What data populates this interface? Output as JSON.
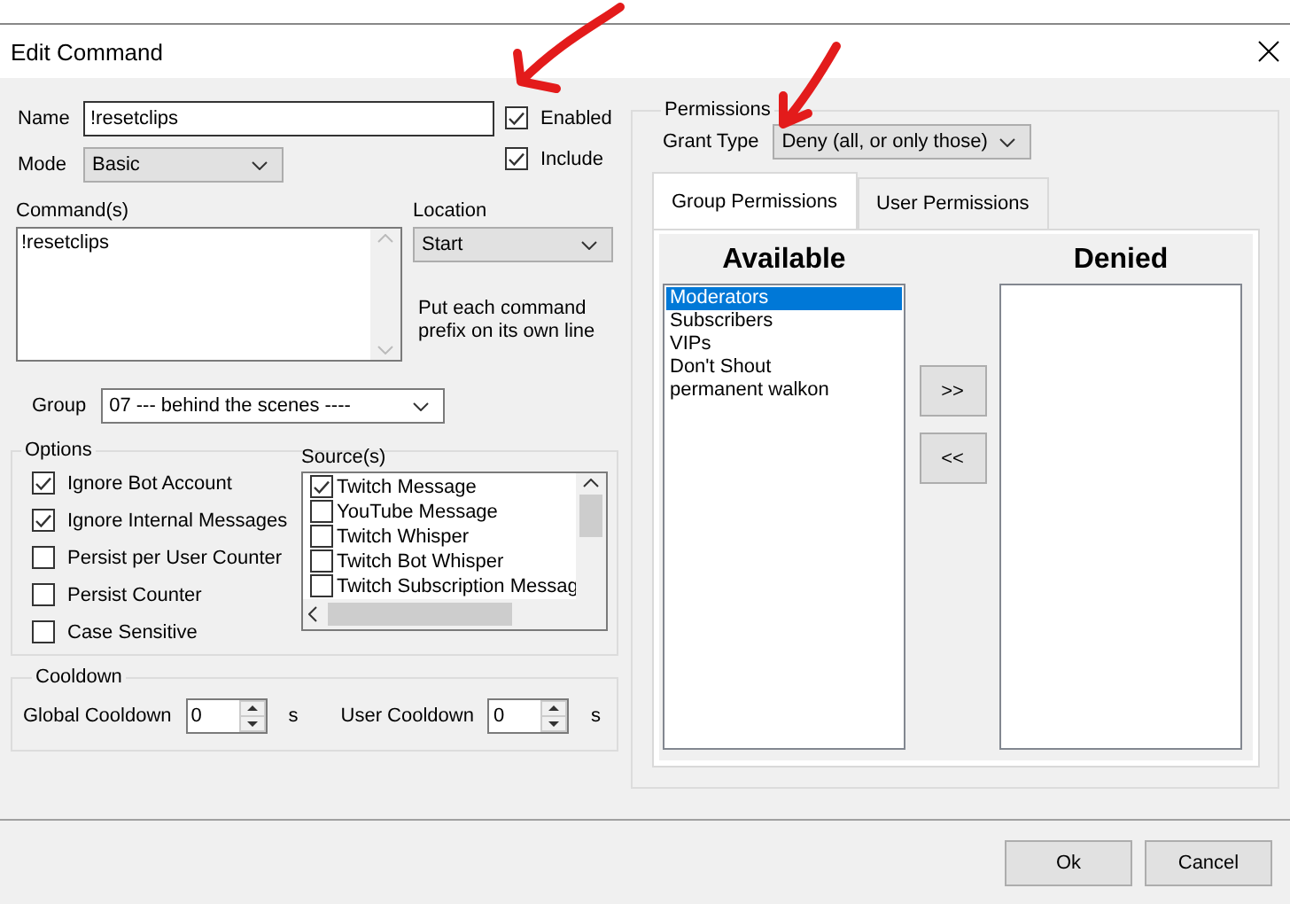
{
  "window": {
    "title": "Edit Command"
  },
  "name_field": {
    "label": "Name",
    "value": "!resetclips"
  },
  "toggles": [
    {
      "label": "Enabled",
      "checked": true
    },
    {
      "label": "Include",
      "checked": true
    }
  ],
  "mode": {
    "label": "Mode",
    "value": "Basic"
  },
  "commands": {
    "label": "Command(s)",
    "value": "!resetclips"
  },
  "location": {
    "label": "Location",
    "value": "Start",
    "hint": "Put each command prefix on its own line"
  },
  "group": {
    "label": "Group",
    "value": "07 --- behind the scenes ----"
  },
  "options": {
    "title": "Options",
    "items": [
      {
        "label": "Ignore Bot Account",
        "checked": true
      },
      {
        "label": "Ignore Internal Messages",
        "checked": true
      },
      {
        "label": "Persist per User Counter",
        "checked": false
      },
      {
        "label": "Persist Counter",
        "checked": false
      },
      {
        "label": "Case Sensitive",
        "checked": false
      }
    ],
    "sources": {
      "label": "Source(s)",
      "items": [
        {
          "label": "Twitch Message",
          "checked": true
        },
        {
          "label": "YouTube Message",
          "checked": false
        },
        {
          "label": "Twitch Whisper",
          "checked": false
        },
        {
          "label": "Twitch Bot Whisper",
          "checked": false
        },
        {
          "label": "Twitch Subscription Messag",
          "checked": false
        }
      ]
    }
  },
  "cooldown": {
    "title": "Cooldown",
    "fields": [
      {
        "label": "Global Cooldown",
        "value": "0",
        "unit": "s"
      },
      {
        "label": "User Cooldown",
        "value": "0",
        "unit": "s"
      }
    ]
  },
  "permissions": {
    "title": "Permissions",
    "grant_type": {
      "label": "Grant Type",
      "value": "Deny (all, or only those)"
    },
    "tabs": [
      {
        "label": "Group Permissions",
        "selected": true
      },
      {
        "label": "User Permissions",
        "selected": false
      }
    ],
    "available": {
      "title": "Available",
      "items": [
        {
          "label": "Moderators",
          "selected": true
        },
        {
          "label": "Subscribers",
          "selected": false
        },
        {
          "label": "VIPs",
          "selected": false
        },
        {
          "label": "Don't Shout",
          "selected": false
        },
        {
          "label": "permanent walkon",
          "selected": false
        }
      ]
    },
    "denied": {
      "title": "Denied"
    },
    "move_buttons": [
      ">>",
      "<<"
    ]
  },
  "buttons": [
    "Ok",
    "Cancel"
  ]
}
